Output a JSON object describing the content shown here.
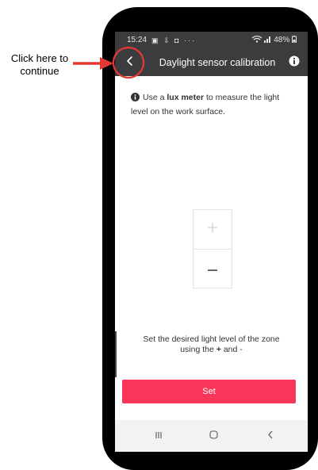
{
  "annotation": {
    "callout_line1": "Click here to",
    "callout_line2": "continue",
    "accent_color": "#e53935"
  },
  "status_bar": {
    "time": "15:24",
    "left_icons": "▣ ⇩ ◘ ···",
    "battery": "48%"
  },
  "app_bar": {
    "back_icon": "chevron-left-icon",
    "title": "Daylight sensor calibration",
    "info_icon": "info-icon"
  },
  "instruction": {
    "prefix": "Use a",
    "bold": "lux meter",
    "suffix": "to measure the light",
    "line2": "level on the work surface."
  },
  "stepper": {
    "plus": "+",
    "minus": "−"
  },
  "hint": {
    "line1": "Set the desired light level of the zone",
    "line2_prefix": "using the",
    "line2_bold": "+",
    "line2_suffix": "and -"
  },
  "set_button": {
    "label": "Set",
    "color": "#f7365a"
  },
  "nav_bar": {
    "recents_icon": "recents-icon",
    "home_icon": "home-icon",
    "back_icon": "back-icon"
  }
}
